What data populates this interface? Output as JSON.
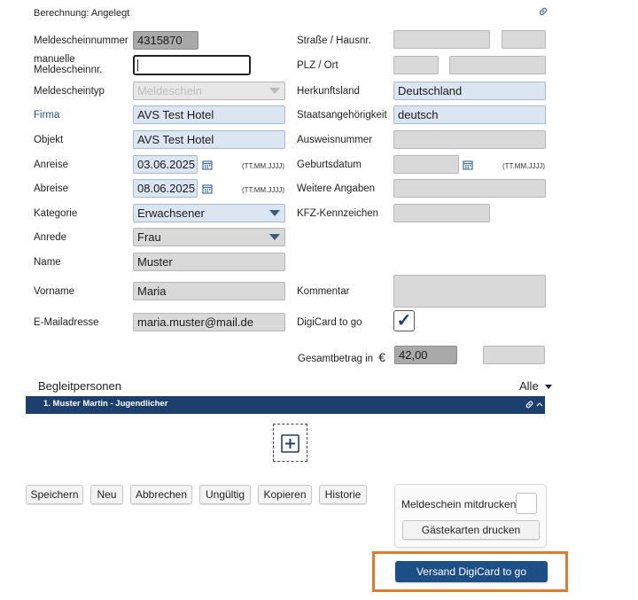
{
  "header": {
    "status": "Berechnung: Angelegt"
  },
  "left": {
    "meldescheinnummer": {
      "label": "Meldescheinnummer",
      "value": "4315870"
    },
    "manuell": {
      "label_line1": "manuelle",
      "label_line2": "Meldescheinnr.",
      "value": ""
    },
    "meldescheintyp": {
      "label": "Meldescheintyp",
      "value": "Meldeschein"
    },
    "firma": {
      "label": "Firma",
      "value": "AVS Test Hotel"
    },
    "objekt": {
      "label": "Objekt",
      "value": "AVS Test Hotel"
    },
    "anreise": {
      "label": "Anreise",
      "value": "03.06.2025",
      "format": "(TT.MM.JJJJ)"
    },
    "abreise": {
      "label": "Abreise",
      "value": "08.06.2025",
      "format": "(TT.MM.JJJJ)"
    },
    "kategorie": {
      "label": "Kategorie",
      "value": "Erwachsener"
    },
    "anrede": {
      "label": "Anrede",
      "value": "Frau"
    },
    "name": {
      "label": "Name",
      "value": "Muster"
    },
    "vorname": {
      "label": "Vorname",
      "value": "Maria"
    },
    "email": {
      "label": "E-Mailadresse",
      "value": "maria.muster@mail.de"
    }
  },
  "right": {
    "strasse": {
      "label": "Straße / Hausnr.",
      "value": "",
      "nr": ""
    },
    "plz": {
      "label": "PLZ / Ort",
      "plz": "",
      "ort": ""
    },
    "herkunftsland": {
      "label": "Herkunftsland",
      "value": "Deutschland"
    },
    "staatsangehoerigkeit": {
      "label": "Staatsangehörigkeit",
      "value": "deutsch"
    },
    "ausweisnummer": {
      "label": "Ausweisnummer",
      "value": ""
    },
    "geburtsdatum": {
      "label": "Geburtsdatum",
      "value": "",
      "format": "(TT.MM.JJJJ)"
    },
    "weitere": {
      "label": "Weitere Angaben",
      "value": ""
    },
    "kfz": {
      "label": "KFZ-Kennzeichen",
      "value": ""
    },
    "kommentar": {
      "label": "Kommentar",
      "value": ""
    },
    "digicard": {
      "label": "DigiCard to go",
      "checked": true,
      "check_glyph": "✓"
    },
    "gesamtbetrag": {
      "label": "Gesamtbetrag in",
      "currency": "€",
      "value": "42,00",
      "extra": ""
    }
  },
  "begleit": {
    "title": "Begleitpersonen",
    "filter": "Alle",
    "rows": [
      {
        "label": "1. Muster Martin - Jugendlicher"
      }
    ]
  },
  "buttons": [
    "Speichern",
    "Neu",
    "Abbrechen",
    "Ungültig",
    "Kopieren",
    "Historie"
  ],
  "print_box": {
    "label": "Meldeschein mitdrucken",
    "guest_button": "Gästekarten drucken"
  },
  "send_button": "Versand DigiCard to go",
  "colors": {
    "accent": "#1c3f6e",
    "highlight": "#e07b2e",
    "field_hl": "#dbe6f2"
  },
  "icons": [
    "link-icon",
    "calendar-icon",
    "chevron-down-icon",
    "plus-icon",
    "check-icon"
  ]
}
